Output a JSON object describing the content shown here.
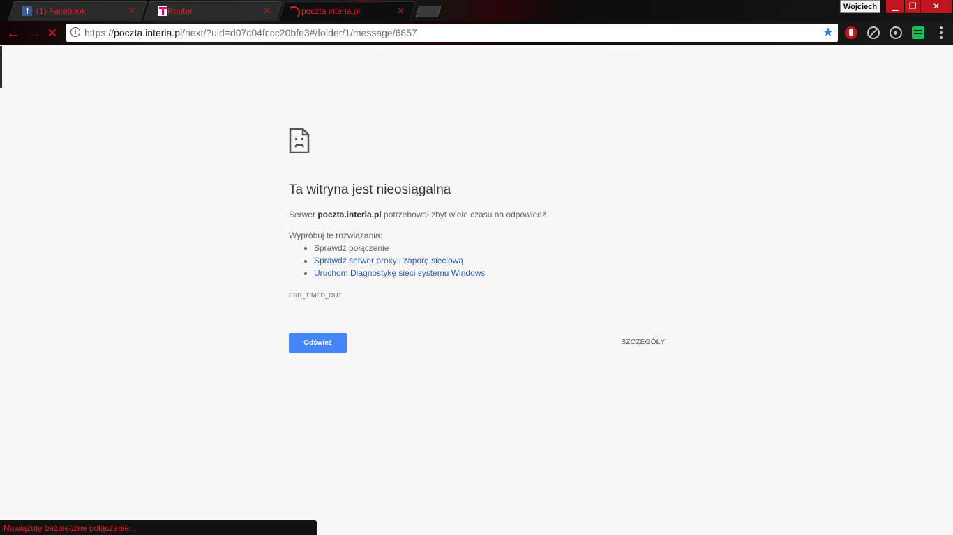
{
  "browser": {
    "tabs": [
      {
        "title": "(1) Facebook",
        "icon": "facebook-icon",
        "active": false
      },
      {
        "title": "Router",
        "icon": "telekom-icon",
        "active": false
      },
      {
        "title": "poczta.interia.pl",
        "icon": "loading-spinner-icon",
        "active": true
      }
    ],
    "profile_name": "Wojciech",
    "window_buttons": {
      "minimize": "▁",
      "maximize": "❐",
      "close": "✕"
    },
    "nav": {
      "back": "←",
      "forward": "→",
      "stop": "✕"
    },
    "url": {
      "scheme": "https://",
      "host": "poczta.interia.pl",
      "path": "/next/?uid=d07c04fccc20bfe3#/folder/1/message/6857"
    },
    "bookmark_star": "★",
    "extensions": [
      "ublock-icon",
      "block-icon",
      "lightbulb-icon",
      "spotify-icon"
    ],
    "accent_color": "#c0161d"
  },
  "error_page": {
    "icon": "sad-document-icon",
    "heading": "Ta witryna jest nieosiągalna",
    "description_prefix": "Serwer ",
    "description_host": "poczta.interia.pl",
    "description_suffix": " potrzebował zbyt wiele czasu na odpowiedź.",
    "try_label": "Wypróbuj te rozwiązania:",
    "suggestions": [
      "Sprawdź połączenie",
      "Sprawdź serwer proxy i zaporę sieciową",
      "Uruchom Diagnostykę sieci systemu Windows"
    ],
    "error_code": "ERR_TIMED_OUT",
    "reload_label": "Odśwież",
    "details_label": "SZCZEGÓŁY"
  },
  "status": {
    "text": "Nawiązuję bezpieczne połączenie..."
  }
}
